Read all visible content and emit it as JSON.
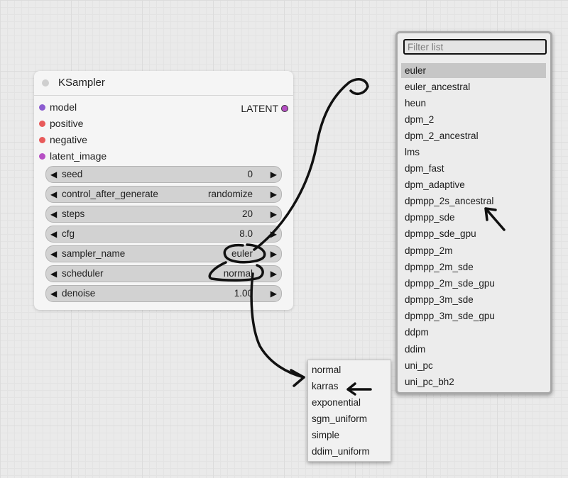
{
  "node": {
    "title": "KSampler",
    "inputs": [
      {
        "label": "model",
        "color": "#8b5cd0"
      },
      {
        "label": "positive",
        "color": "#e85a5a"
      },
      {
        "label": "negative",
        "color": "#e85a5a"
      },
      {
        "label": "latent_image",
        "color": "#b64fc4"
      }
    ],
    "output": {
      "label": "LATENT",
      "color": "#b64fc4"
    },
    "widgets": [
      {
        "label": "seed",
        "value": "0"
      },
      {
        "label": "control_after_generate",
        "value": "randomize"
      },
      {
        "label": "steps",
        "value": "20"
      },
      {
        "label": "cfg",
        "value": "8.0"
      },
      {
        "label": "sampler_name",
        "value": "euler"
      },
      {
        "label": "scheduler",
        "value": "normal"
      },
      {
        "label": "denoise",
        "value": "1.00"
      }
    ],
    "arrow_left": "◀",
    "arrow_right": "▶"
  },
  "sampler_menu": {
    "filter_placeholder": "Filter list",
    "selected": "euler",
    "items": [
      "euler",
      "euler_ancestral",
      "heun",
      "dpm_2",
      "dpm_2_ancestral",
      "lms",
      "dpm_fast",
      "dpm_adaptive",
      "dpmpp_2s_ancestral",
      "dpmpp_sde",
      "dpmpp_sde_gpu",
      "dpmpp_2m",
      "dpmpp_2m_sde",
      "dpmpp_2m_sde_gpu",
      "dpmpp_3m_sde",
      "dpmpp_3m_sde_gpu",
      "ddpm",
      "ddim",
      "uni_pc",
      "uni_pc_bh2"
    ]
  },
  "scheduler_menu": {
    "items": [
      "normal",
      "karras",
      "exponential",
      "sgm_uniform",
      "simple",
      "ddim_uniform"
    ]
  },
  "annotations": {
    "stroke_color": "#111111",
    "icons": [
      "hand-drawn-circle-icon",
      "hand-drawn-arrow-icon"
    ]
  }
}
